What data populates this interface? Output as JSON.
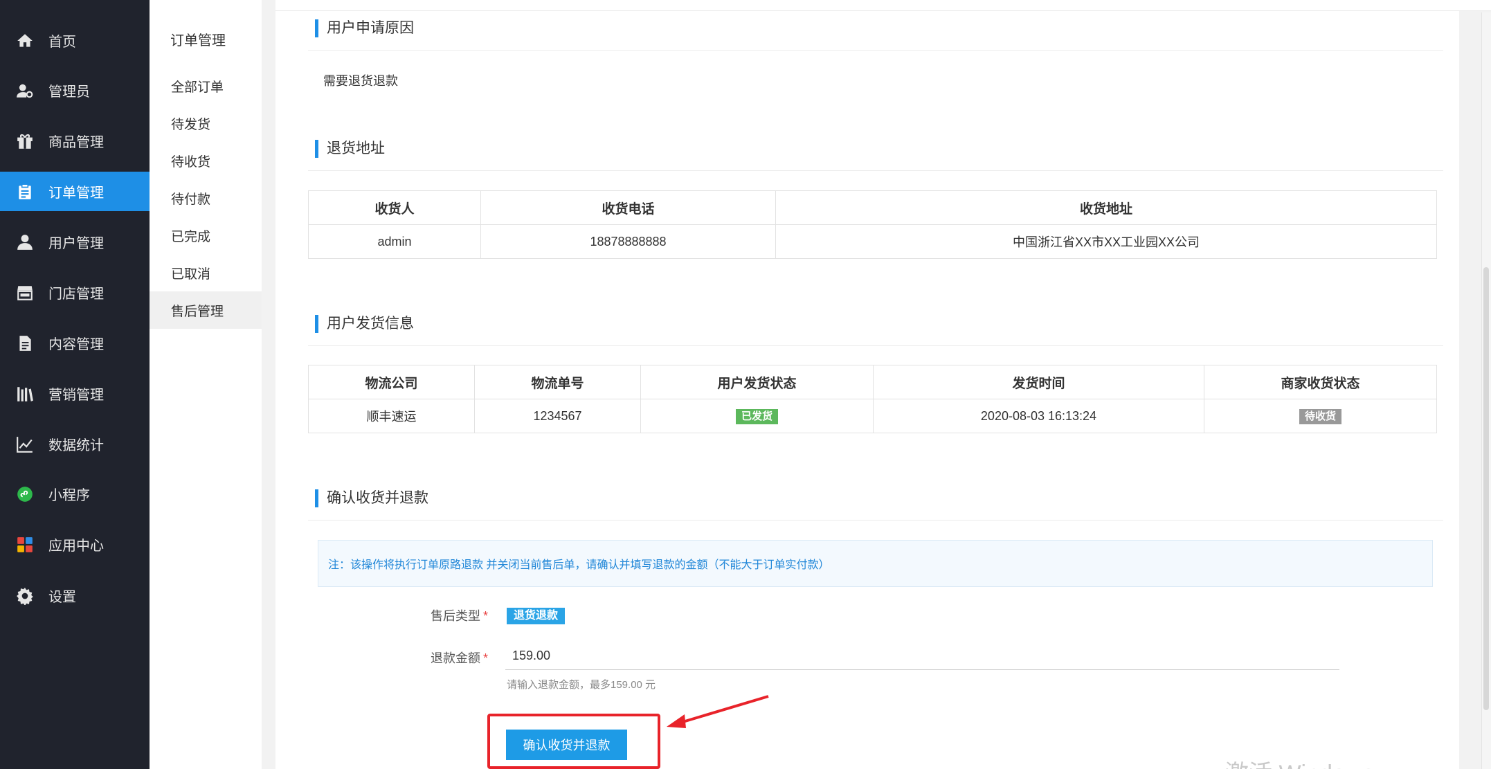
{
  "sidebar": {
    "items": [
      {
        "label": "首页",
        "icon": "home-icon"
      },
      {
        "label": "管理员",
        "icon": "admin-user-icon"
      },
      {
        "label": "商品管理",
        "icon": "gift-icon"
      },
      {
        "label": "订单管理",
        "icon": "clipboard-icon",
        "active": true
      },
      {
        "label": "用户管理",
        "icon": "user-icon"
      },
      {
        "label": "门店管理",
        "icon": "store-icon"
      },
      {
        "label": "内容管理",
        "icon": "document-icon"
      },
      {
        "label": "营销管理",
        "icon": "books-icon"
      },
      {
        "label": "数据统计",
        "icon": "line-chart-icon"
      },
      {
        "label": "小程序",
        "icon": "mini-program-icon"
      },
      {
        "label": "应用中心",
        "icon": "apps-icon"
      },
      {
        "label": "设置",
        "icon": "gear-icon"
      }
    ]
  },
  "subnav": {
    "title": "订单管理",
    "items": [
      {
        "label": "全部订单"
      },
      {
        "label": "待发货"
      },
      {
        "label": "待收货"
      },
      {
        "label": "待付款"
      },
      {
        "label": "已完成"
      },
      {
        "label": "已取消"
      },
      {
        "label": "售后管理",
        "active": true
      }
    ]
  },
  "sections": {
    "reason_title": "用户申请原因",
    "reason_text": "需要退货退款",
    "address_title": "退货地址",
    "shipping_title": "用户发货信息",
    "confirm_title": "确认收货并退款"
  },
  "address_table": {
    "headers": [
      "收货人",
      "收货电话",
      "收货地址"
    ],
    "row": [
      "admin",
      "18878888888",
      "中国浙江省XX市XX工业园XX公司"
    ]
  },
  "shipping_table": {
    "headers": [
      "物流公司",
      "物流单号",
      "用户发货状态",
      "发货时间",
      "商家收货状态"
    ],
    "row": {
      "company": "顺丰速运",
      "tracking_no": "1234567",
      "user_status": "已发货",
      "ship_time": "2020-08-03 16:13:24",
      "merchant_status": "待收货"
    }
  },
  "form": {
    "note": "注：该操作将执行订单原路退款 并关闭当前售后单，请确认并填写退款的金额（不能大于订单实付款）",
    "type_label": "售后类型",
    "type_value": "退货退款",
    "amount_label": "退款金额",
    "amount_value": "159.00",
    "amount_hint": "请输入退款金额，最多159.00 元",
    "required_mark": "*",
    "submit_label": "确认收货并退款"
  },
  "colors": {
    "sidebar_bg": "#20232d",
    "accent": "#1e8fe6",
    "shipped_green": "#5cb85c",
    "pending_gray": "#999999",
    "highlight_red": "#e8232a"
  },
  "watermark": "激活 Windows"
}
